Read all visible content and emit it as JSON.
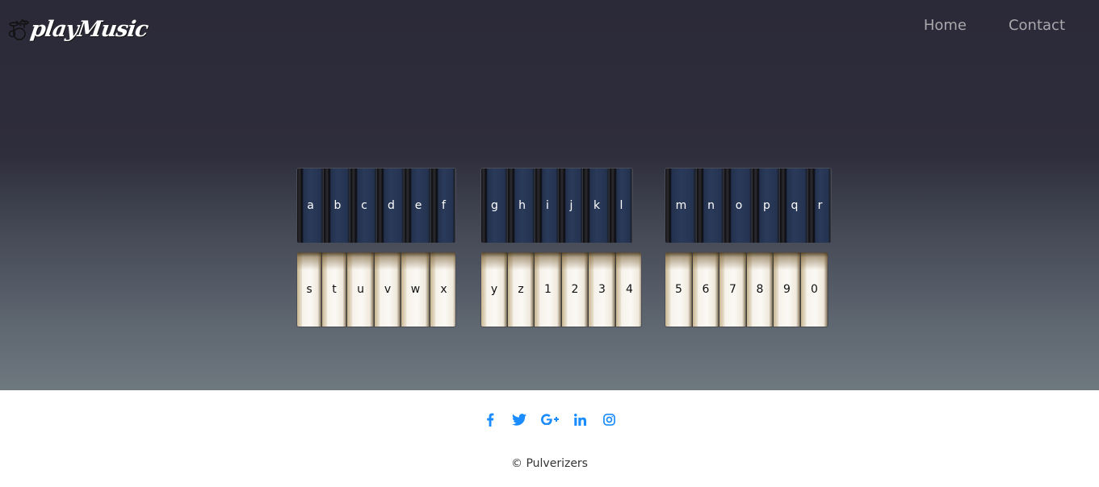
{
  "brand": {
    "name": "playMusic",
    "logo_icon": "drum-kit-icon"
  },
  "nav": {
    "home": "Home",
    "contact": "Contact"
  },
  "keyboard": {
    "dark_groups": [
      [
        "a",
        "b",
        "c",
        "d",
        "e",
        "f"
      ],
      [
        "g",
        "h",
        "i",
        "j",
        "k",
        "l"
      ],
      [
        "m",
        "n",
        "o",
        "p",
        "q",
        "r"
      ]
    ],
    "light_groups": [
      [
        "s",
        "t",
        "u",
        "v",
        "w",
        "x"
      ],
      [
        "y",
        "z",
        "1",
        "2",
        "3",
        "4"
      ],
      [
        "5",
        "6",
        "7",
        "8",
        "9",
        "0"
      ]
    ]
  },
  "footer": {
    "social": [
      "facebook-icon",
      "twitter-icon",
      "google-plus-icon",
      "linkedin-icon",
      "instagram-icon"
    ],
    "social_color": "#1a8cff",
    "copyright": "© Pulverizers"
  }
}
